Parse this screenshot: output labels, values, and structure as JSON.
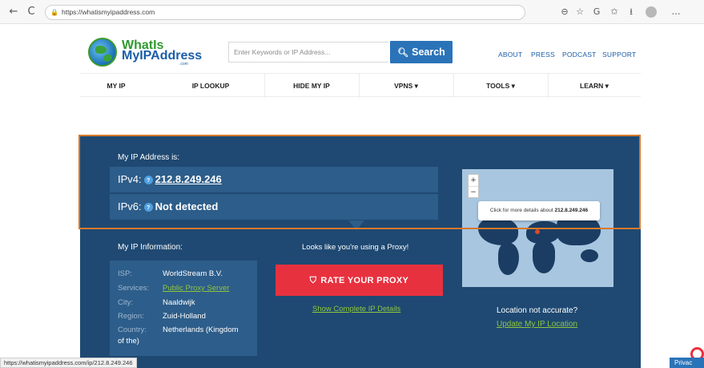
{
  "browser": {
    "back_icon": "←",
    "reload_icon": "C",
    "url": "https://whatismyipaddress.com",
    "toolbar_icons": [
      "⊖",
      "☆",
      "G",
      "✩",
      "⭳",
      "ℰ",
      "…"
    ]
  },
  "site": {
    "logo_text_1": "WhatIs",
    "logo_text_2": "MyIPAddress",
    "logo_dotcom": ".com",
    "search_placeholder": "Enter Keywords or IP Address...",
    "search_button": "Search",
    "top_links": [
      "ABOUT",
      "PRESS",
      "PODCAST",
      "SUPPORT"
    ],
    "nav": [
      "MY IP",
      "IP LOOKUP",
      "HIDE MY IP",
      "VPNS ▾",
      "TOOLS ▾",
      "LEARN ▾"
    ]
  },
  "ip_panel": {
    "label": "My IP Address is:",
    "ipv4_label": "IPv4:",
    "ipv4_value": "212.8.249.246",
    "ipv6_label": "IPv6:",
    "ipv6_value": "Not detected",
    "help_icon": "?"
  },
  "map": {
    "zoom_in": "+",
    "zoom_out": "−",
    "tooltip_prefix": "Click for more details about",
    "tooltip_ip": "212.8.249.246"
  },
  "info": {
    "label": "My IP Information:",
    "rows": [
      {
        "key": "ISP:",
        "value": "WorldStream B.V."
      },
      {
        "key": "Services:",
        "value": "Public Proxy Server"
      },
      {
        "key": "City:",
        "value": "Naaldwijk"
      },
      {
        "key": "Region:",
        "value": "Zuid-Holland"
      },
      {
        "key": "Country:",
        "value": "Netherlands (Kingdom"
      }
    ],
    "country_cont": "of the)"
  },
  "proxy": {
    "message": "Looks like you're using a Proxy!",
    "rate_button": "RATE YOUR PROXY",
    "show_details": "Show Complete IP Details"
  },
  "location": {
    "question": "Location not accurate?",
    "update_link": "Update My IP Location"
  },
  "status_url": "https://whatismyipaddress.com/ip/212.8.249.246",
  "privacy_badge": "Privac",
  "colors": {
    "panel": "#1f4972",
    "row": "#2d5d8a",
    "accent_green": "#8ec63f",
    "rate_red": "#e8313f",
    "highlight_orange": "#d8782a",
    "search_blue": "#2b73b8"
  }
}
